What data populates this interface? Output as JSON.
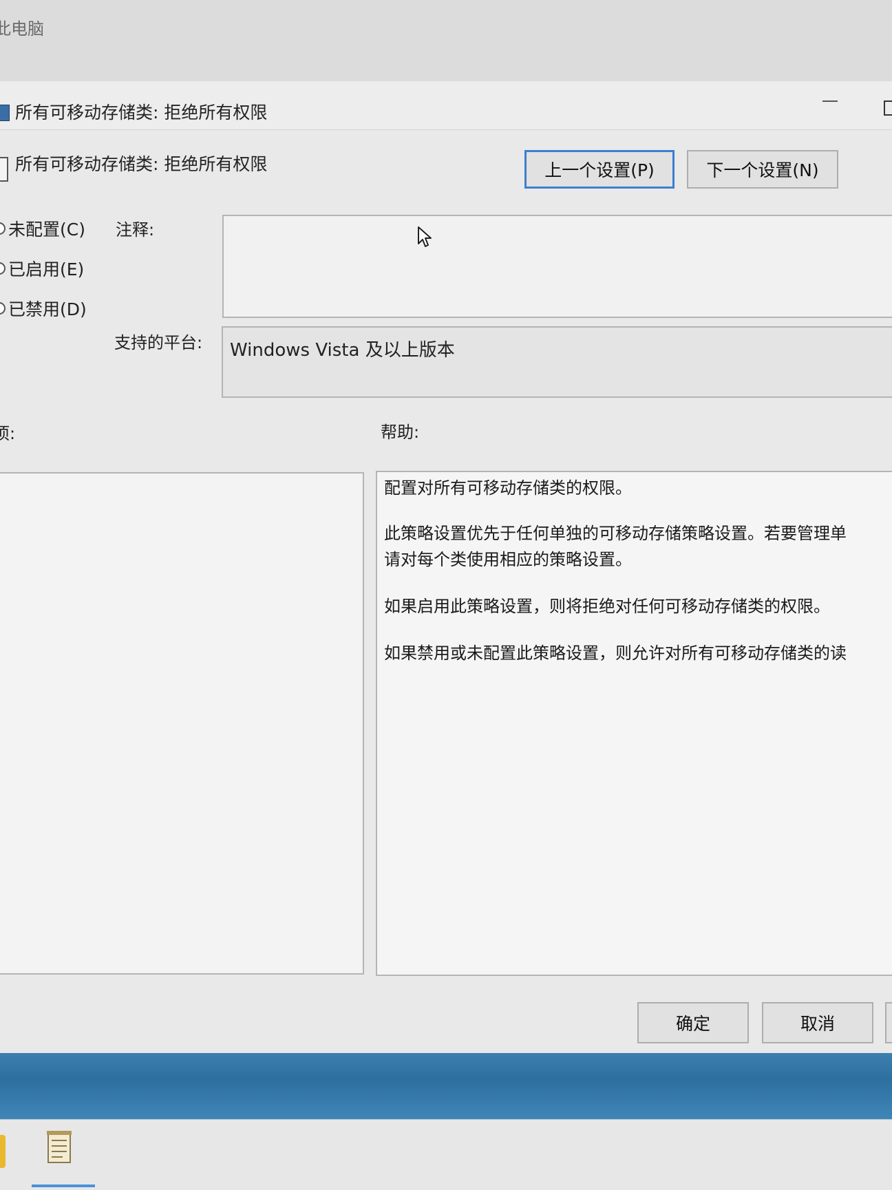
{
  "background_window": {
    "title": "此电脑"
  },
  "dialog": {
    "title": "所有可移动存储类: 拒绝所有权限",
    "policy_name": "所有可移动存储类: 拒绝所有权限",
    "buttons": {
      "prev": "上一个设置(P)",
      "next": "下一个设置(N)",
      "ok": "确定",
      "cancel": "取消"
    },
    "state_options": [
      {
        "label": "未配置(C)"
      },
      {
        "label": "已启用(E)"
      },
      {
        "label": "已禁用(D)"
      }
    ],
    "comment_label": "注释:",
    "comment_value": "",
    "platform_label": "支持的平台:",
    "platform_value": "Windows Vista 及以上版本",
    "options_label": "项:",
    "help_label": "帮助:",
    "help_paragraphs": [
      "配置对所有可移动存储类的权限。",
      "此策略设置优先于任何单独的可移动存储策略设置。若要管理单\n请对每个类使用相应的策略设置。",
      "如果启用此策略设置，则将拒绝对任何可移动存储类的权限。",
      "如果禁用或未配置此策略设置，则允许对所有可移动存储类的读"
    ]
  },
  "taskbar": {
    "icons": [
      "folder-icon",
      "notepad-icon"
    ]
  },
  "colors": {
    "focus_border": "#3c7fd0",
    "dialog_bg": "#e9e9e9",
    "desktop_blue": "#2d6f9f"
  }
}
